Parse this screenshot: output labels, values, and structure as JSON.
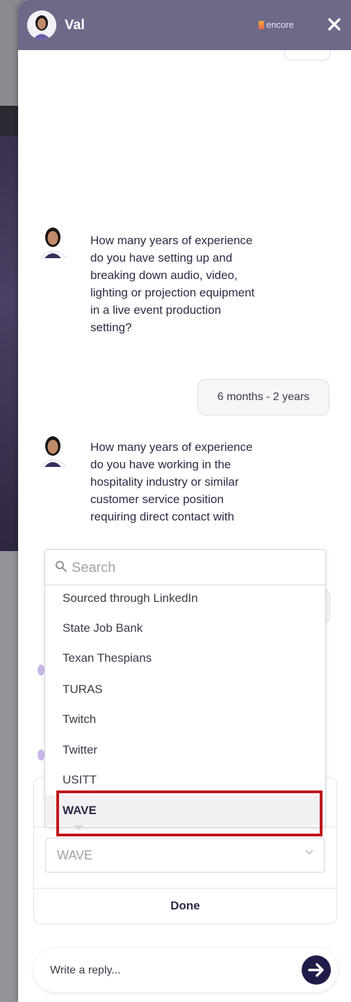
{
  "header": {
    "name": "Val",
    "brand": "encore",
    "close_glyph": "✕"
  },
  "messages": [
    {
      "sender": "bot",
      "text": "How many years of experience do you have setting up and breaking down audio, video, lighting or projection equipment in a live event production setting?"
    },
    {
      "sender": "user",
      "text": "6 months - 2 years"
    },
    {
      "sender": "bot",
      "text": "How many years of experience do you have working in the hospitality industry or similar customer service position requiring direct contact with"
    }
  ],
  "dropdown": {
    "search_placeholder": "Search",
    "options": [
      "Sourced through LinkedIn",
      "State Job Bank",
      "Texan Thespians",
      "TURAS",
      "Twitch",
      "Twitter",
      "USITT",
      "WAVE"
    ],
    "selected": "WAVE"
  },
  "select": {
    "value": "WAVE"
  },
  "done_label": "Done",
  "reply": {
    "placeholder": "Write a reply..."
  },
  "icons": {
    "close": "close-icon",
    "search": "search-icon",
    "chevron": "chevron-down-icon",
    "send": "send-arrow-icon"
  },
  "colors": {
    "header_bg": "#6e6988",
    "send_button": "#1f1c4a",
    "highlight": "#c0161a"
  }
}
